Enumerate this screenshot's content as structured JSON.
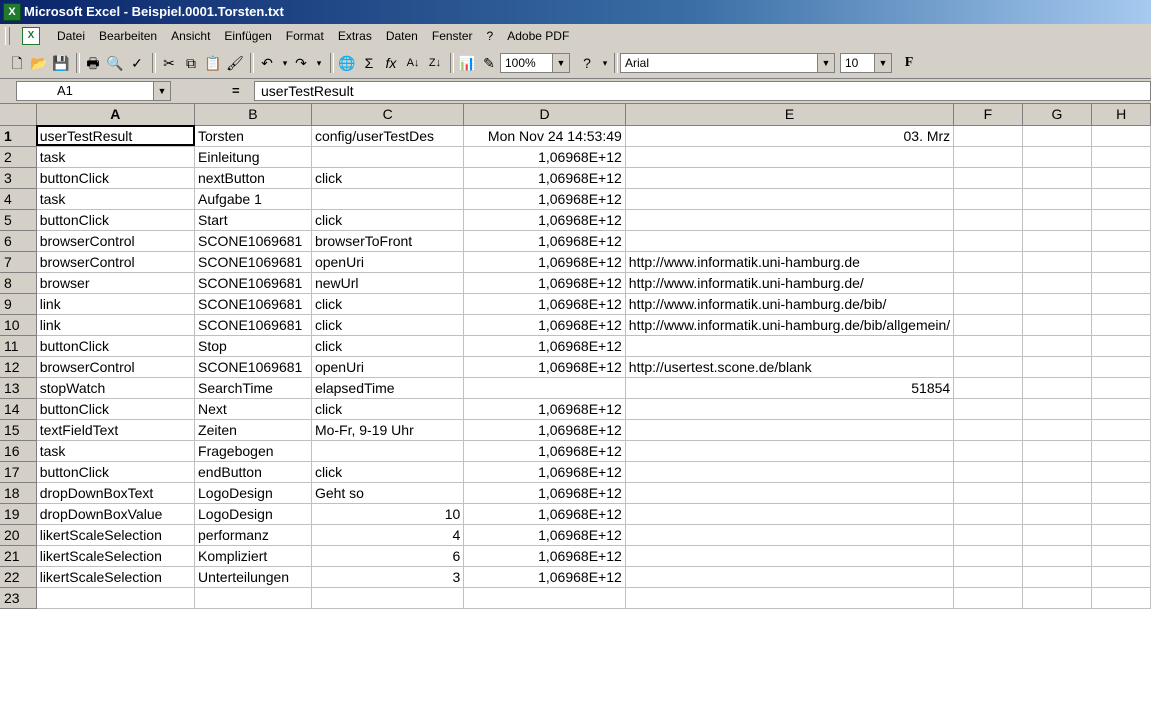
{
  "window": {
    "title": "Microsoft Excel - Beispiel.0001.Torsten.txt",
    "app_icon": "excel-icon"
  },
  "menu": [
    "Datei",
    "Bearbeiten",
    "Ansicht",
    "Einfügen",
    "Format",
    "Extras",
    "Daten",
    "Fenster",
    "?",
    "Adobe PDF"
  ],
  "toolbar": {
    "zoom": "100%",
    "font": "Arial",
    "font_size": "10",
    "bold": "F"
  },
  "formula_bar": {
    "cell_ref": "A1",
    "eq": "=",
    "value": "userTestResult"
  },
  "columns": [
    "A",
    "B",
    "C",
    "D",
    "E",
    "F",
    "G",
    "H"
  ],
  "rows": [
    {
      "n": "1",
      "c": [
        "userTestResult",
        "Torsten",
        "config/userTestDes",
        "Mon Nov 24 14:53:49",
        "03. Mrz",
        "",
        "",
        ""
      ]
    },
    {
      "n": "2",
      "c": [
        "task",
        "Einleitung",
        "",
        "1,06968E+12",
        "",
        "",
        "",
        ""
      ]
    },
    {
      "n": "3",
      "c": [
        "buttonClick",
        "nextButton",
        "click",
        "1,06968E+12",
        "",
        "",
        "",
        ""
      ]
    },
    {
      "n": "4",
      "c": [
        "task",
        "Aufgabe 1",
        "",
        "1,06968E+12",
        "",
        "",
        "",
        ""
      ]
    },
    {
      "n": "5",
      "c": [
        "buttonClick",
        "Start",
        "click",
        "1,06968E+12",
        "",
        "",
        "",
        ""
      ]
    },
    {
      "n": "6",
      "c": [
        "browserControl",
        "SCONE1069681",
        "browserToFront",
        "1,06968E+12",
        "",
        "",
        "",
        ""
      ]
    },
    {
      "n": "7",
      "c": [
        "browserControl",
        "SCONE1069681",
        "openUri",
        "1,06968E+12",
        "http://www.informatik.uni-hamburg.de",
        "",
        "",
        ""
      ]
    },
    {
      "n": "8",
      "c": [
        "browser",
        "SCONE1069681",
        "newUrl",
        "1,06968E+12",
        "http://www.informatik.uni-hamburg.de/",
        "",
        "",
        ""
      ]
    },
    {
      "n": "9",
      "c": [
        "link",
        "SCONE1069681",
        "click",
        "1,06968E+12",
        "http://www.informatik.uni-hamburg.de/bib/",
        "",
        "",
        ""
      ]
    },
    {
      "n": "10",
      "c": [
        "link",
        "SCONE1069681",
        "click",
        "1,06968E+12",
        "http://www.informatik.uni-hamburg.de/bib/allgemein/",
        "",
        "",
        ""
      ]
    },
    {
      "n": "11",
      "c": [
        "buttonClick",
        "Stop",
        "click",
        "1,06968E+12",
        "",
        "",
        "",
        ""
      ]
    },
    {
      "n": "12",
      "c": [
        "browserControl",
        "SCONE1069681",
        "openUri",
        "1,06968E+12",
        "http://usertest.scone.de/blank",
        "",
        "",
        ""
      ]
    },
    {
      "n": "13",
      "c": [
        "stopWatch",
        "SearchTime",
        "elapsedTime",
        "",
        "51854",
        "",
        "",
        ""
      ]
    },
    {
      "n": "14",
      "c": [
        "buttonClick",
        "Next",
        "click",
        "1,06968E+12",
        "",
        "",
        "",
        ""
      ]
    },
    {
      "n": "15",
      "c": [
        "textFieldText",
        "Zeiten",
        "Mo-Fr, 9-19 Uhr",
        "1,06968E+12",
        "",
        "",
        "",
        ""
      ]
    },
    {
      "n": "16",
      "c": [
        "task",
        "Fragebogen",
        "",
        "1,06968E+12",
        "",
        "",
        "",
        ""
      ]
    },
    {
      "n": "17",
      "c": [
        "buttonClick",
        "endButton",
        "click",
        "1,06968E+12",
        "",
        "",
        "",
        ""
      ]
    },
    {
      "n": "18",
      "c": [
        "dropDownBoxText",
        "LogoDesign",
        "Geht so",
        "1,06968E+12",
        "",
        "",
        "",
        ""
      ]
    },
    {
      "n": "19",
      "c": [
        "dropDownBoxValue",
        "LogoDesign",
        "10",
        "1,06968E+12",
        "",
        "",
        "",
        ""
      ]
    },
    {
      "n": "20",
      "c": [
        "likertScaleSelection",
        "performanz",
        "4",
        "1,06968E+12",
        "",
        "",
        "",
        ""
      ]
    },
    {
      "n": "21",
      "c": [
        "likertScaleSelection",
        "Kompliziert",
        "6",
        "1,06968E+12",
        "",
        "",
        "",
        ""
      ]
    },
    {
      "n": "22",
      "c": [
        "likertScaleSelection",
        "Unterteilungen",
        "3",
        "1,06968E+12",
        "",
        "",
        "",
        ""
      ]
    },
    {
      "n": "23",
      "c": [
        "",
        "",
        "",
        "",
        "",
        "",
        "",
        ""
      ]
    }
  ]
}
